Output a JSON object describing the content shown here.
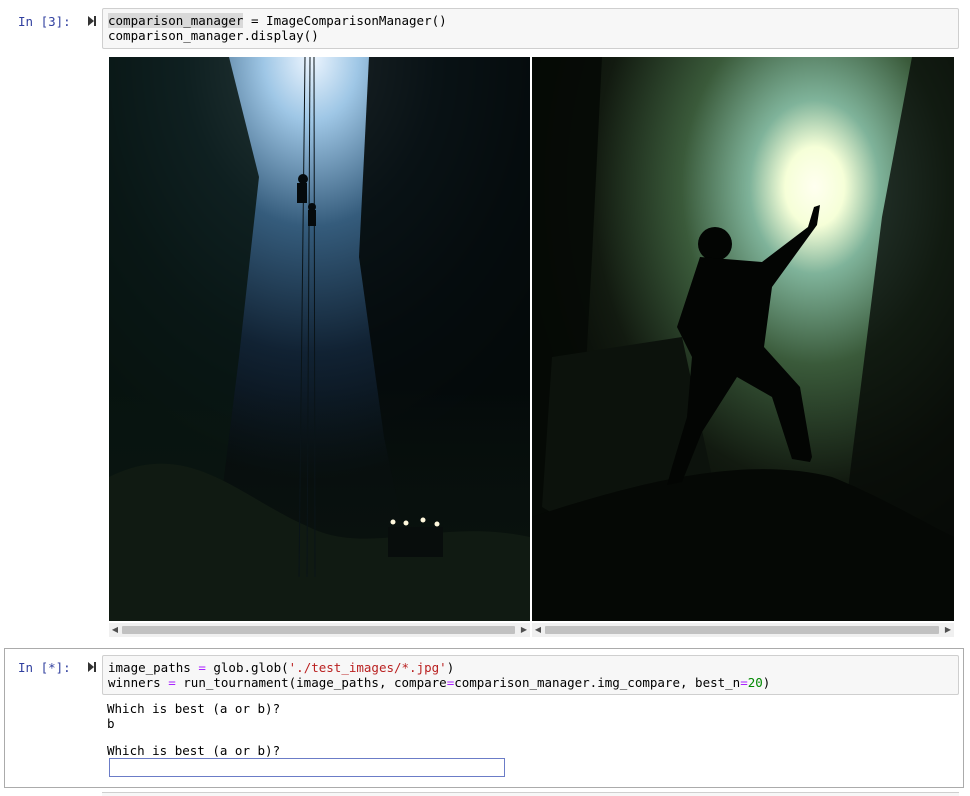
{
  "cells": [
    {
      "prompt": "In [3]:",
      "code": {
        "line1_var": "comparison_manager",
        "line1_op": " = ",
        "line1_rest": "ImageComparisonManager()",
        "line2": "comparison_manager.display()"
      },
      "images": [
        {
          "description_icon": "cave-rappel-photo-icon"
        },
        {
          "description_icon": "caver-silhouette-photo-icon"
        }
      ]
    },
    {
      "prompt": "In [*]:",
      "code": {
        "l1_a": "image_paths ",
        "l1_op": "=",
        "l1_b": " glob.glob(",
        "l1_str": "'./test_images/*.jpg'",
        "l1_c": ")",
        "l2_a": "winners ",
        "l2_op": "=",
        "l2_b": " run_tournament(image_paths, compare",
        "l2_op2": "=",
        "l2_c": "comparison_manager.img_compare, best_n",
        "l2_op3": "=",
        "l2_num": "20",
        "l2_d": ")"
      },
      "output": {
        "q1": "Which is best (a or b)?",
        "a1": "b",
        "q2": "Which is best (a or b)?",
        "input_value": ""
      }
    }
  ],
  "colors": {
    "prompt": "#303f9f",
    "string": "#ba2121",
    "number": "#008800",
    "operator": "#aa22ff"
  }
}
